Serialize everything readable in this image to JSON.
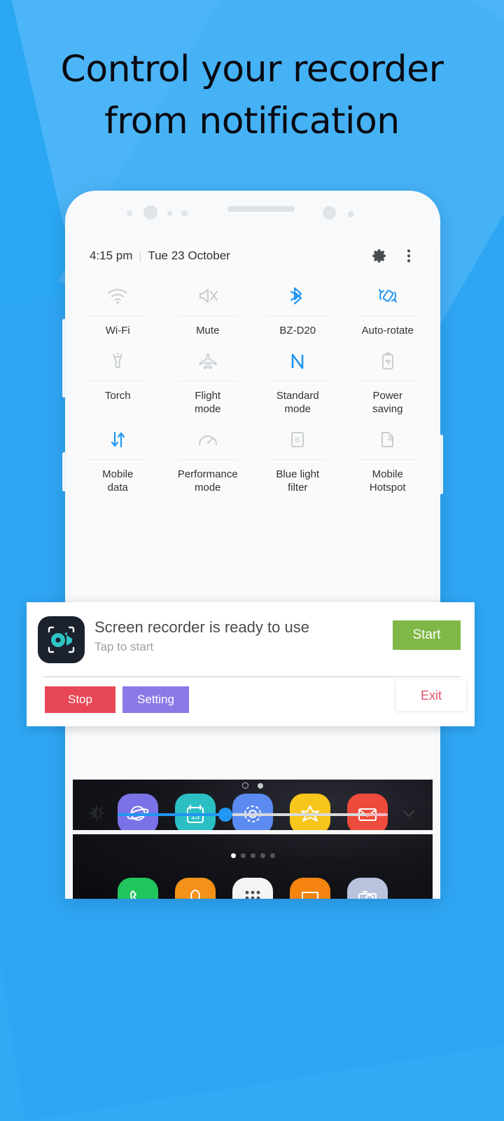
{
  "theme": {
    "background_blue": "#2BA7F4",
    "accent_blue": "#2196f3",
    "start_green": "#7fb846",
    "stop_red": "#e84756",
    "setting_purple": "#8a7ae8",
    "exit_red": "#e0526a"
  },
  "headline": {
    "line1": "Control your recorder",
    "line2": "from notification"
  },
  "quick_panel": {
    "clock": "4:15 pm",
    "separator": "|",
    "date": "Tue 23 October",
    "settings_icon": "gear-icon",
    "more_icon": "more-vertical-icon",
    "tiles": [
      {
        "label": "Wi-Fi",
        "icon": "wifi-icon",
        "active": false
      },
      {
        "label": "Mute",
        "icon": "mute-icon",
        "active": false
      },
      {
        "label": "BZ-D20",
        "icon": "bluetooth-icon",
        "active": true
      },
      {
        "label": "Auto-rotate",
        "icon": "auto-rotate-icon",
        "active": true
      },
      {
        "label": "Torch",
        "icon": "flashlight-icon",
        "active": false
      },
      {
        "label": "Flight\nmode",
        "icon": "airplane-icon",
        "active": false
      },
      {
        "label": "Standard\nmode",
        "icon": "nfc-icon",
        "active": true
      },
      {
        "label": "Power\nsaving",
        "icon": "battery-saver-icon",
        "active": false
      },
      {
        "label": "Mobile\ndata",
        "icon": "data-transfer-icon",
        "active": true
      },
      {
        "label": "Performance\nmode",
        "icon": "speedometer-icon",
        "active": false
      },
      {
        "label": "Blue light\nfilter",
        "icon": "blue-light-filter-icon",
        "active": false
      },
      {
        "label": "Mobile\nHotspot",
        "icon": "hotspot-icon",
        "active": false
      }
    ],
    "panel_pages": {
      "count": 2,
      "current": 1
    },
    "brightness": {
      "icon": "brightness-icon",
      "value_percent": 40,
      "expand_icon": "chevron-down-icon"
    }
  },
  "notification": {
    "app_icon": "screen-recorder-app-icon",
    "title": "Screen recorder is ready to use",
    "subtitle": "Tap to start",
    "start_label": "Start",
    "stop_label": "Stop",
    "setting_label": "Setting",
    "exit_label": "Exit"
  },
  "home_screen": {
    "page_dots": {
      "count": 5,
      "current": 1
    },
    "row1": [
      {
        "name": "browser-app-icon",
        "color": "#7b72e8",
        "glyph": "planet-icon"
      },
      {
        "name": "calendar-app-icon",
        "color": "#2bbfc4",
        "glyph": "calendar-icon",
        "day": "13"
      },
      {
        "name": "settings-app-icon",
        "color": "#5b8bf0",
        "glyph": "gear-icon"
      },
      {
        "name": "gallery-app-icon",
        "color": "#f8c51c",
        "glyph": "flower-icon"
      },
      {
        "name": "email-app-icon",
        "color": "#ef4b3c",
        "glyph": "envelope-icon"
      }
    ],
    "row2": [
      {
        "name": "phone-app-icon",
        "color": "#22c55e",
        "glyph": "phone-icon"
      },
      {
        "name": "contacts-app-icon",
        "color": "#f49119",
        "glyph": "contact-icon"
      },
      {
        "name": "app-drawer-icon",
        "color": "#f4f4f4",
        "glyph": "grid-dots-icon"
      },
      {
        "name": "messages-app-icon",
        "color": "#f4840f",
        "glyph": "chat-icon"
      },
      {
        "name": "camera-app-icon",
        "color": "#b9c3dd",
        "glyph": "camera-icon"
      }
    ]
  }
}
